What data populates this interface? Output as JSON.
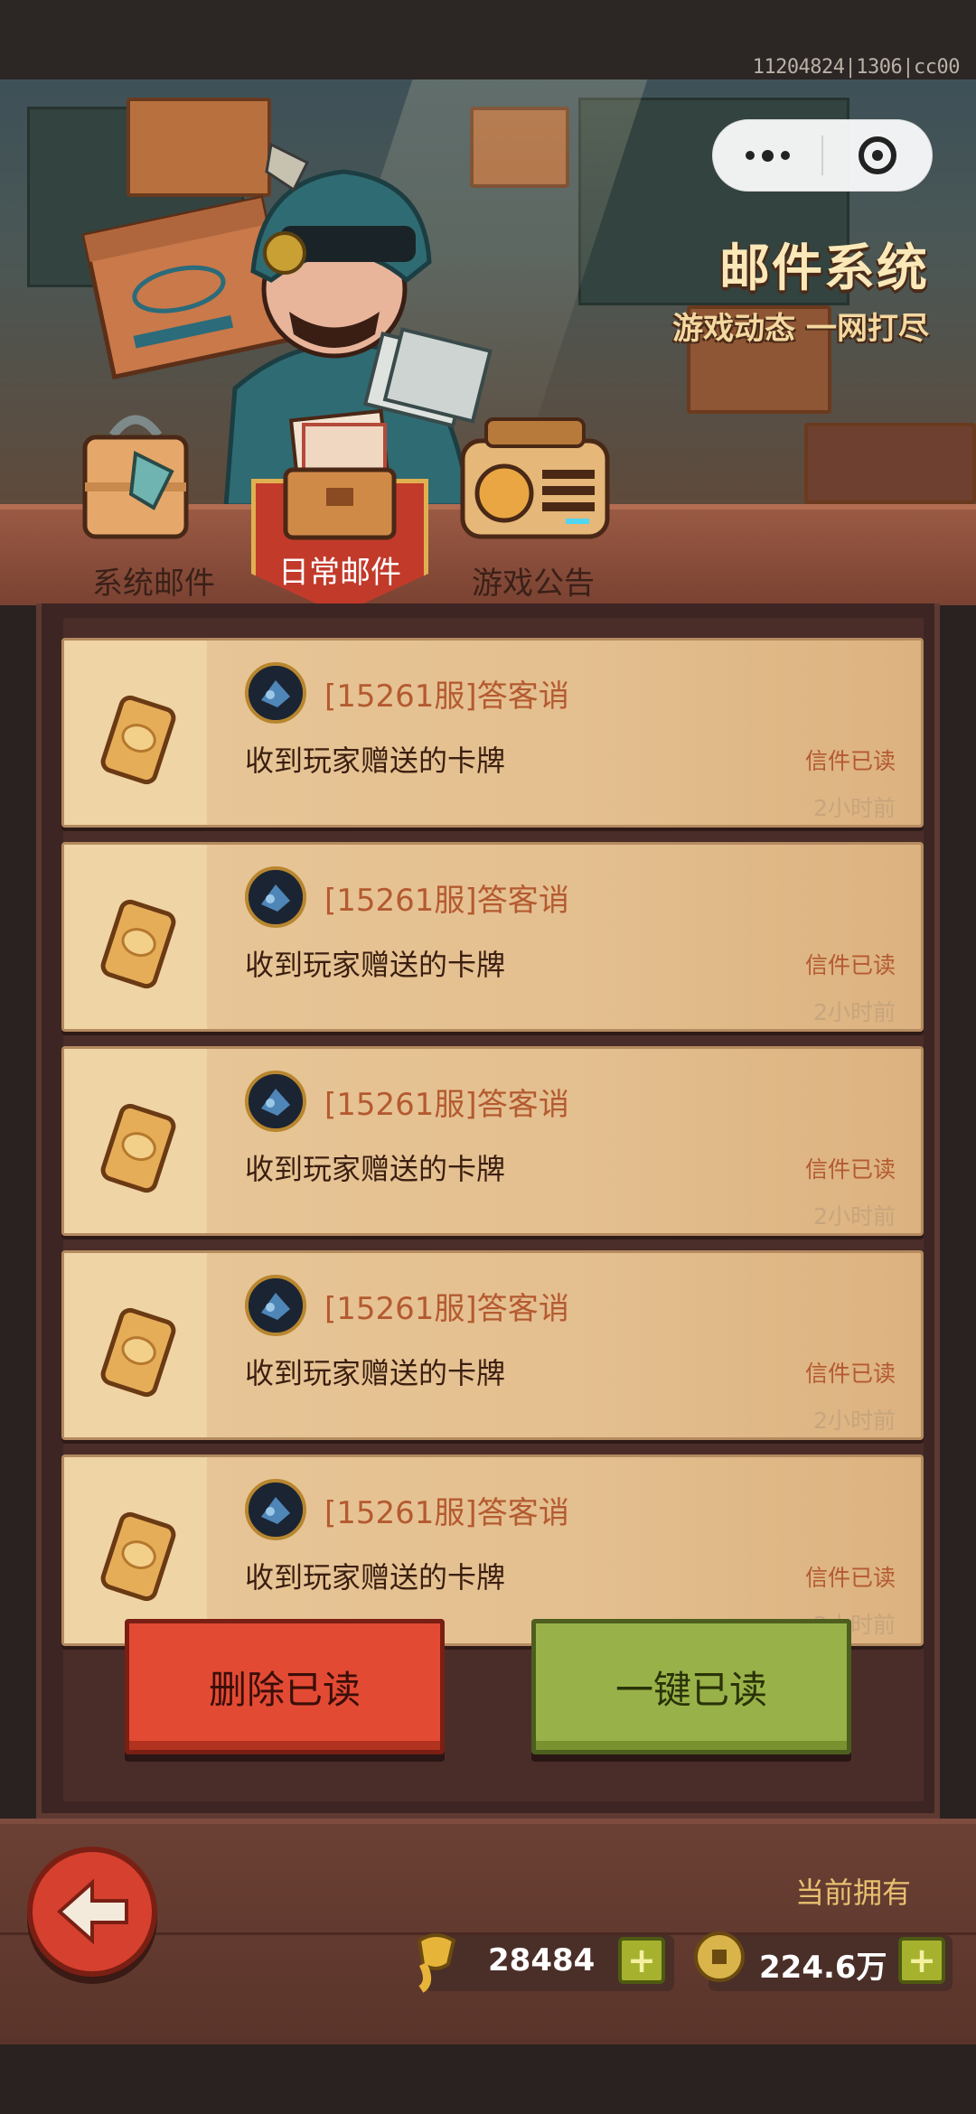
{
  "build_id": "11204824|1306|cc00",
  "header": {
    "title": "邮件系统",
    "subtitle": "游戏动态 一网打尽"
  },
  "tabs": [
    {
      "label": "系统邮件",
      "active": false
    },
    {
      "label": "日常邮件",
      "active": true
    },
    {
      "label": "游戏公告",
      "active": false
    }
  ],
  "mails": [
    {
      "sender": "[15261服]答客诮",
      "subject": "收到玩家赠送的卡牌",
      "status": "信件已读",
      "time": "2小时前"
    },
    {
      "sender": "[15261服]答客诮",
      "subject": "收到玩家赠送的卡牌",
      "status": "信件已读",
      "time": "2小时前"
    },
    {
      "sender": "[15261服]答客诮",
      "subject": "收到玩家赠送的卡牌",
      "status": "信件已读",
      "time": "2小时前"
    },
    {
      "sender": "[15261服]答客诮",
      "subject": "收到玩家赠送的卡牌",
      "status": "信件已读",
      "time": "2小时前"
    },
    {
      "sender": "[15261服]答客诮",
      "subject": "收到玩家赠送的卡牌",
      "status": "信件已读",
      "time": "2小时前"
    }
  ],
  "actions": {
    "delete_read": "删除已读",
    "mark_all_read": "一键已读"
  },
  "footer": {
    "owned_label": "当前拥有",
    "resource1_value": "28484",
    "resource2_value": "224.6万"
  },
  "colors": {
    "accent_red": "#e34a34",
    "accent_green": "#98b249",
    "title_cream": "#fbe8b8"
  },
  "icons": [
    "more-dots-icon",
    "target-icon",
    "mailbox-icon",
    "letter-box-icon",
    "radio-icon",
    "card-icon",
    "avatar",
    "back-arrow-icon",
    "gold-scroll-icon",
    "coin-icon",
    "plus-icon"
  ]
}
